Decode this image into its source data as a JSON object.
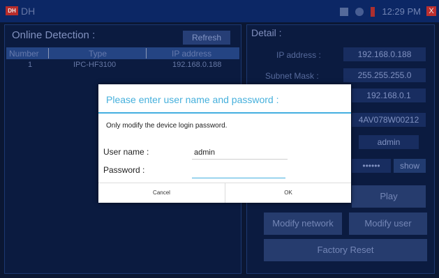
{
  "statusbar": {
    "logo": "DH",
    "app_name": "DH",
    "time": "12:29 PM",
    "close": "X"
  },
  "online": {
    "title": "Online Detection :",
    "refresh_label": "Refresh",
    "columns": [
      "Number",
      "Type",
      "IP address"
    ],
    "rows": [
      {
        "number": "1",
        "type": "IPC-HF3100",
        "ip": "192.168.0.188"
      }
    ]
  },
  "detail": {
    "title": "Detail :",
    "ip_label": "IP address :",
    "ip_value": "192.168.0.188",
    "mask_label": "Subnet Mask :",
    "mask_value": "255.255.255.0",
    "gateway_value": "192.168.0.1",
    "serial_value": "4AV078W00212",
    "user_value": "admin",
    "password_masked": "••••••",
    "show_label": "show",
    "play_label": "Play",
    "modify_network_label": "Modify network",
    "modify_user_label": "Modify user",
    "factory_reset_label": "Factory Reset"
  },
  "dialog": {
    "title": "Please enter user name and password  :",
    "message": "Only modify the device login password.",
    "user_label": "User name :",
    "user_value": "admin",
    "password_label": "Password :",
    "password_value": "",
    "cancel_label": "Cancel",
    "ok_label": "OK"
  },
  "colors": {
    "accent": "#43afe0",
    "background": "#0d1a38",
    "close": "#cc3333"
  }
}
